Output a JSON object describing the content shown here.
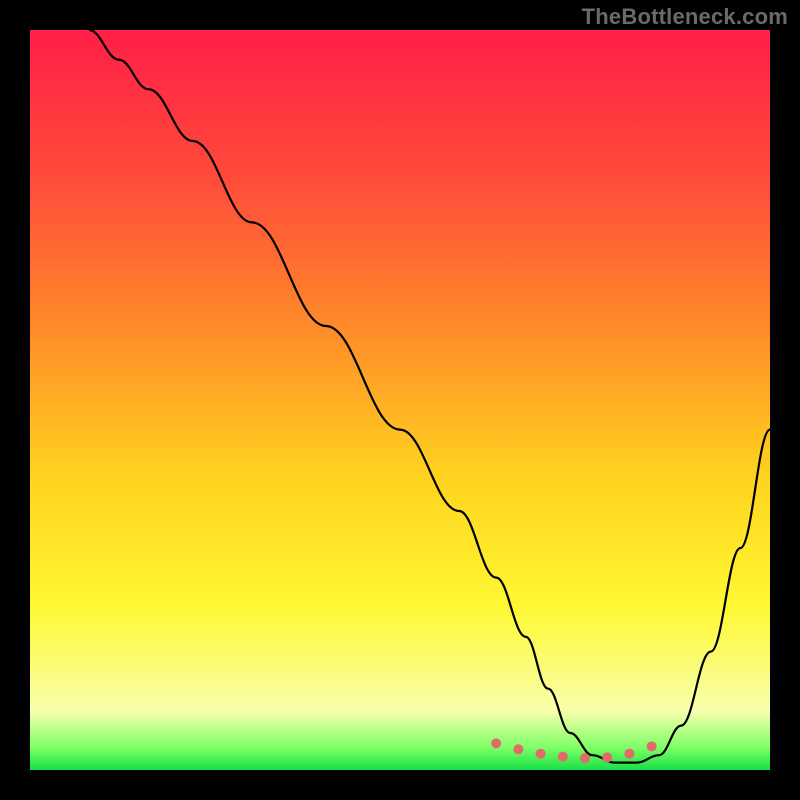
{
  "watermark": "TheBottleneck.com",
  "chart_data": {
    "type": "line",
    "title": "",
    "xlabel": "",
    "ylabel": "",
    "xlim": [
      0,
      100
    ],
    "ylim": [
      0,
      100
    ],
    "gradient_stops": [
      {
        "offset": 0,
        "color": "#ff1f47"
      },
      {
        "offset": 20,
        "color": "#ff4b3a"
      },
      {
        "offset": 40,
        "color": "#ff8a2a"
      },
      {
        "offset": 60,
        "color": "#ffd21f"
      },
      {
        "offset": 78,
        "color": "#fff833"
      },
      {
        "offset": 92,
        "color": "#f8ffac"
      },
      {
        "offset": 97,
        "color": "#7dff66"
      },
      {
        "offset": 100,
        "color": "#17e044"
      }
    ],
    "series": [
      {
        "name": "curve",
        "color": "#000000",
        "x": [
          8,
          12,
          16,
          22,
          30,
          40,
          50,
          58,
          63,
          67,
          70,
          73,
          76,
          79,
          82,
          85,
          88,
          92,
          96,
          100
        ],
        "y": [
          100,
          96,
          92,
          85,
          74,
          60,
          46,
          35,
          26,
          18,
          11,
          5,
          2,
          1,
          1,
          2,
          6,
          16,
          30,
          46
        ]
      }
    ],
    "markers": {
      "color": "#e16a6a",
      "x": [
        63,
        66,
        69,
        72,
        75,
        78,
        81,
        84
      ],
      "y": [
        3.6,
        2.8,
        2.2,
        1.8,
        1.6,
        1.7,
        2.2,
        3.2
      ]
    }
  }
}
